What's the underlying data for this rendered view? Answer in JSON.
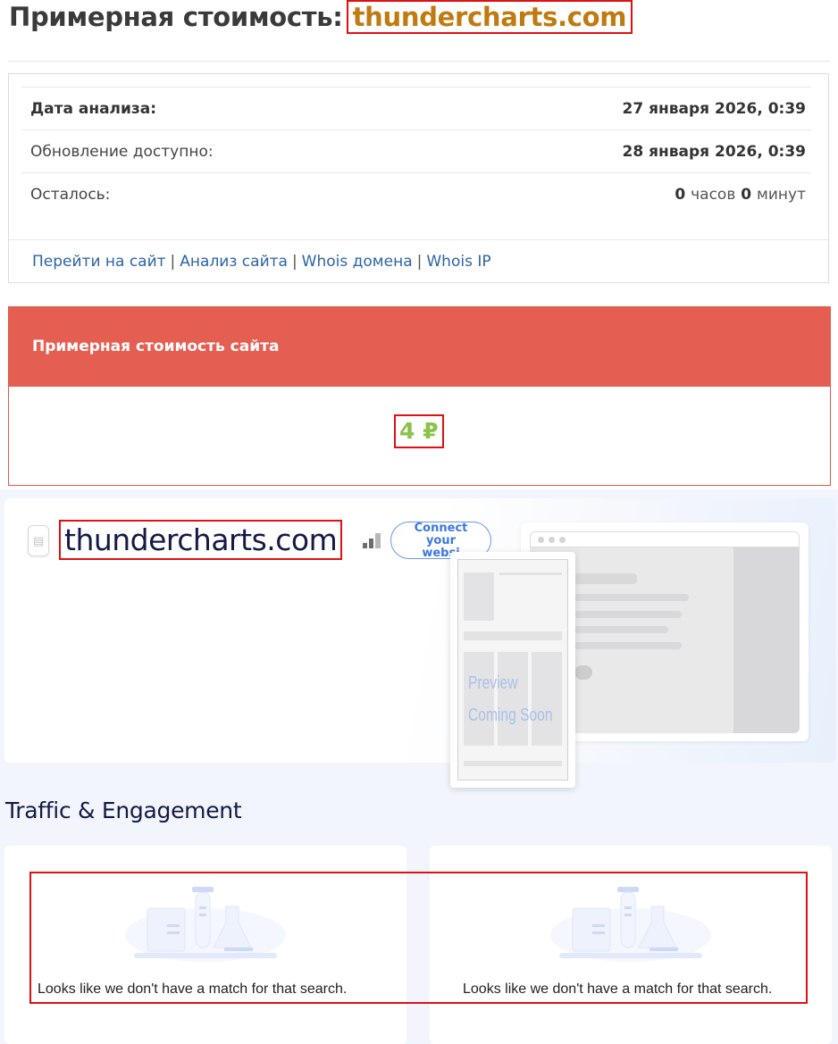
{
  "header": {
    "title_prefix": "Примерная стоимость:",
    "domain": "thundercharts.com"
  },
  "info": {
    "rows": [
      {
        "label": "Дата анализа:",
        "value": "27 января 2026, 0:39"
      },
      {
        "label": "Обновление доступно:",
        "value": "28 января 2026, 0:39"
      },
      {
        "label": "Осталось:",
        "hours": "0",
        "hours_unit": "часов",
        "minutes": "0",
        "minutes_unit": "минут"
      }
    ],
    "links": [
      "Перейти на сайт",
      "Анализ сайта",
      "Whois домена",
      "Whois IP"
    ],
    "separator": "|"
  },
  "cost": {
    "title": "Примерная стоимость сайта",
    "value": "4 ₽",
    "value_color": "#8bc34a",
    "header_color": "#e45f51"
  },
  "site_card": {
    "domain": "thundercharts.com",
    "connect_button": [
      "Connect",
      "your",
      "websi"
    ],
    "preview_text": [
      "Preview",
      "Coming Soon"
    ],
    "icons": {
      "document": "document-icon",
      "rank": "rank-bars-icon"
    }
  },
  "traffic": {
    "title": "Traffic & Engagement",
    "cards": [
      {
        "message": "Looks like we don't have a match for that search."
      },
      {
        "message": "Looks like we don't have a match for that search."
      }
    ]
  }
}
